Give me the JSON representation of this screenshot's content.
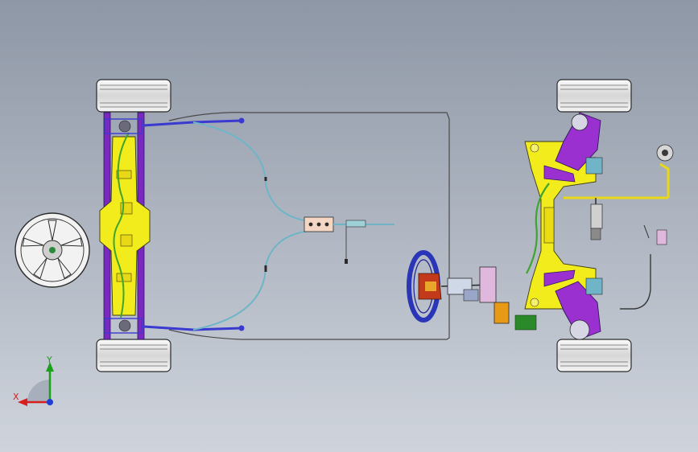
{
  "viewport": {
    "background_top": "#8e97a6",
    "background_bottom": "#cfd4dc"
  },
  "triad": {
    "x_label": "X",
    "y_label": "Y",
    "x_color": "#d81e1e",
    "y_color": "#1aa01a",
    "z_color": "#1e3cd8"
  },
  "colors": {
    "tire": "#e4e4e4",
    "tire_line": "#2a2a2a",
    "subframe_yellow": "#f2ec1c",
    "link_purple": "#8a28c8",
    "link_blue": "#3a3ad0",
    "brake_line": "#5a5a5a",
    "hose_cyan": "#6fb5c7",
    "harness_green": "#3fa52c",
    "steering_wheel": "#2a35b8",
    "accent_orange": "#e89a16",
    "accent_pink": "#d98ac8"
  }
}
